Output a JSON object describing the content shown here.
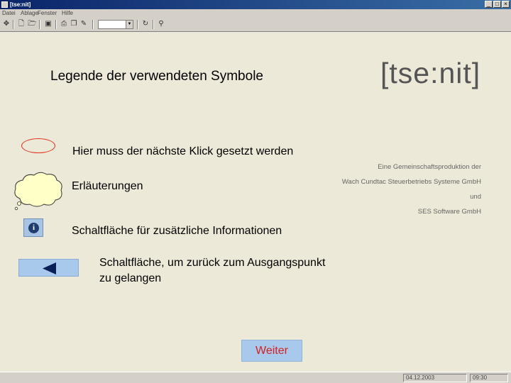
{
  "window": {
    "title": "[tse:nit]",
    "minimize": "_",
    "maximize": "□",
    "close": "×"
  },
  "menu": {
    "items": [
      "Datei",
      "Ablage",
      "Fenster",
      "Hilfe"
    ]
  },
  "toolbar": {
    "zoom_value": ""
  },
  "slide": {
    "heading": "Legende der verwendeten Symbole",
    "logo": "[tse:nit]",
    "credits": [
      "Eine Gemeinschaftsproduktion der",
      "Wach Cundtac Steuerbetriebs Systeme GmbH",
      "und",
      "SES Software GmbH"
    ],
    "legend": {
      "click_hint": "Hier muss der nächste Klick gesetzt werden",
      "explanations": "Erläuterungen",
      "info_button": "Schaltfläche für zusätzliche Informationen",
      "back_button_line1": "Schaltfläche, um zurück zum Ausgangspunkt",
      "back_button_line2": "zu gelangen"
    },
    "info_glyph": "i",
    "next_label": "Weiter"
  },
  "colors": {
    "accent_red": "#e0301e",
    "button_blue": "#a8c8ec",
    "logo_gray": "#555555"
  },
  "statusbar": {
    "date": "04.12.2003",
    "time": "09:30"
  }
}
